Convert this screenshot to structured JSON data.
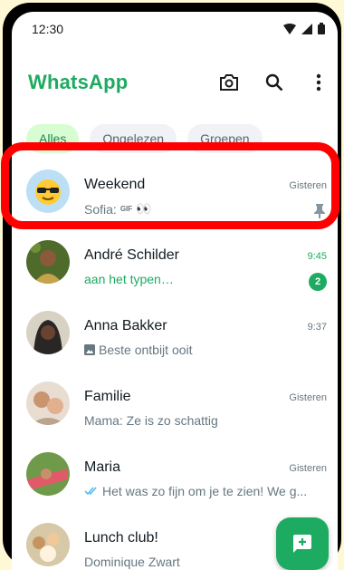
{
  "status": {
    "time": "12:30"
  },
  "appbar": {
    "title": "WhatsApp",
    "icons": [
      "camera-icon",
      "search-icon",
      "more-vert-icon"
    ]
  },
  "filters": [
    {
      "label": "Alles",
      "active": true
    },
    {
      "label": "Ongelezen",
      "active": false
    },
    {
      "label": "Groepen",
      "active": false
    }
  ],
  "chats": [
    {
      "name": "Weekend",
      "preview_sender": "Sofia:",
      "preview_gif": "GIF",
      "preview_emoji": "👀",
      "time": "Gisteren",
      "pinned": true
    },
    {
      "name": "André Schilder",
      "preview": "aan het typen…",
      "time": "9:45",
      "unread": "2",
      "typing": true
    },
    {
      "name": "Anna Bakker",
      "preview": "Beste ontbijt ooit",
      "time": "9:37",
      "photo_icon": true
    },
    {
      "name": "Familie",
      "preview": "Mama: Ze is zo schattig",
      "time": "Gisteren"
    },
    {
      "name": "Maria",
      "preview": "Het was zo fijn om je te zien! We g...",
      "time": "Gisteren",
      "read_ticks": true
    },
    {
      "name": "Lunch club!",
      "preview": "Dominique Zwart",
      "time": ""
    }
  ],
  "colors": {
    "accent": "#1daa61",
    "chip_active_bg": "#d9fdd3",
    "highlight": "#ff0000"
  }
}
